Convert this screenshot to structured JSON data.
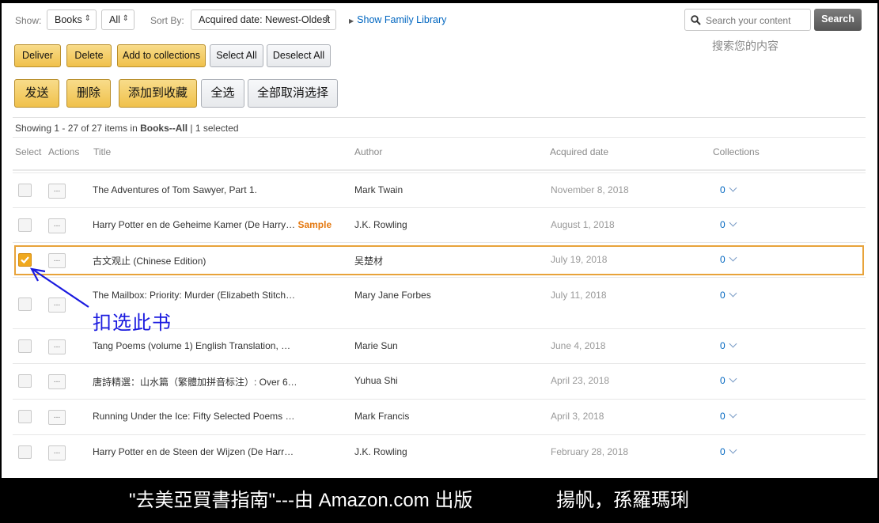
{
  "filters": {
    "show_label": "Show:",
    "type_value": "Books",
    "scope_value": "All",
    "sort_label": "Sort By:",
    "sort_value": "Acquired date: Newest-Oldest",
    "family_link": "Show Family Library"
  },
  "search": {
    "placeholder": "Search your content",
    "button": "Search",
    "cn_hint": "搜索您的内容"
  },
  "actions_en": {
    "deliver": "Deliver",
    "delete": "Delete",
    "add_collections": "Add to collections",
    "select_all": "Select All",
    "deselect_all": "Deselect All"
  },
  "actions_cn": {
    "deliver": "发送",
    "delete": "删除",
    "add_collections": "添加到收藏",
    "select_all": "全选",
    "deselect_all": "全部取消选择"
  },
  "summary": {
    "prefix": "Showing 1 - 27 of 27 items in ",
    "scope": "Books--All",
    "suffix": " | 1 selected"
  },
  "table": {
    "headers": {
      "select": "Select",
      "actions": "Actions",
      "title": "Title",
      "author": "Author",
      "date": "Acquired date",
      "collections": "Collections"
    },
    "action_glyph": "...",
    "rows": [
      {
        "title": "The Adventures of Tom Sawyer, Part 1.",
        "author": "Mark Twain",
        "date": "November 8, 2018",
        "collections": "0",
        "checked": false
      },
      {
        "title": "Harry Potter en de Geheime Kamer (De Harry…",
        "sample": "Sample",
        "author": "J.K. Rowling",
        "date": "August 1, 2018",
        "collections": "0",
        "checked": false
      },
      {
        "title": "古文观止 (Chinese Edition)",
        "author": "吴楚材",
        "date": "July 19, 2018",
        "collections": "0",
        "checked": true
      },
      {
        "title": "The Mailbox: Priority: Murder (Elizabeth Stitch…",
        "author": "Mary Jane Forbes",
        "date": "July 11, 2018",
        "collections": "0",
        "checked": false
      },
      {
        "title": "Tang Poems (volume 1) English Translation, …",
        "author": "Marie Sun",
        "date": "June 4, 2018",
        "collections": "0",
        "checked": false
      },
      {
        "title": "唐詩精選：山水篇（繁體加拼音标注）: Over 6…",
        "author": "Yuhua Shi",
        "date": "April 23, 2018",
        "collections": "0",
        "checked": false
      },
      {
        "title": "Running Under the Ice: Fifty Selected Poems …",
        "author": "Mark Francis",
        "date": "April 3, 2018",
        "collections": "0",
        "checked": false
      },
      {
        "title": "Harry Potter en de Steen der Wijzen (De Harr…",
        "author": "J.K. Rowling",
        "date": "February 28, 2018",
        "collections": "0",
        "checked": false
      }
    ]
  },
  "annotation": {
    "text": "扣选此书",
    "color": "#1a1adf",
    "highlight_color": "#e8a33a"
  },
  "caption": {
    "left": "\"去美亞買書指南\"---由 Amazon.com 出版",
    "right": "揚帆，孫羅瑪琍"
  },
  "colors": {
    "button_yellow": "#f0c14b",
    "link_blue": "#0066c0",
    "sample_orange": "#e47911"
  }
}
